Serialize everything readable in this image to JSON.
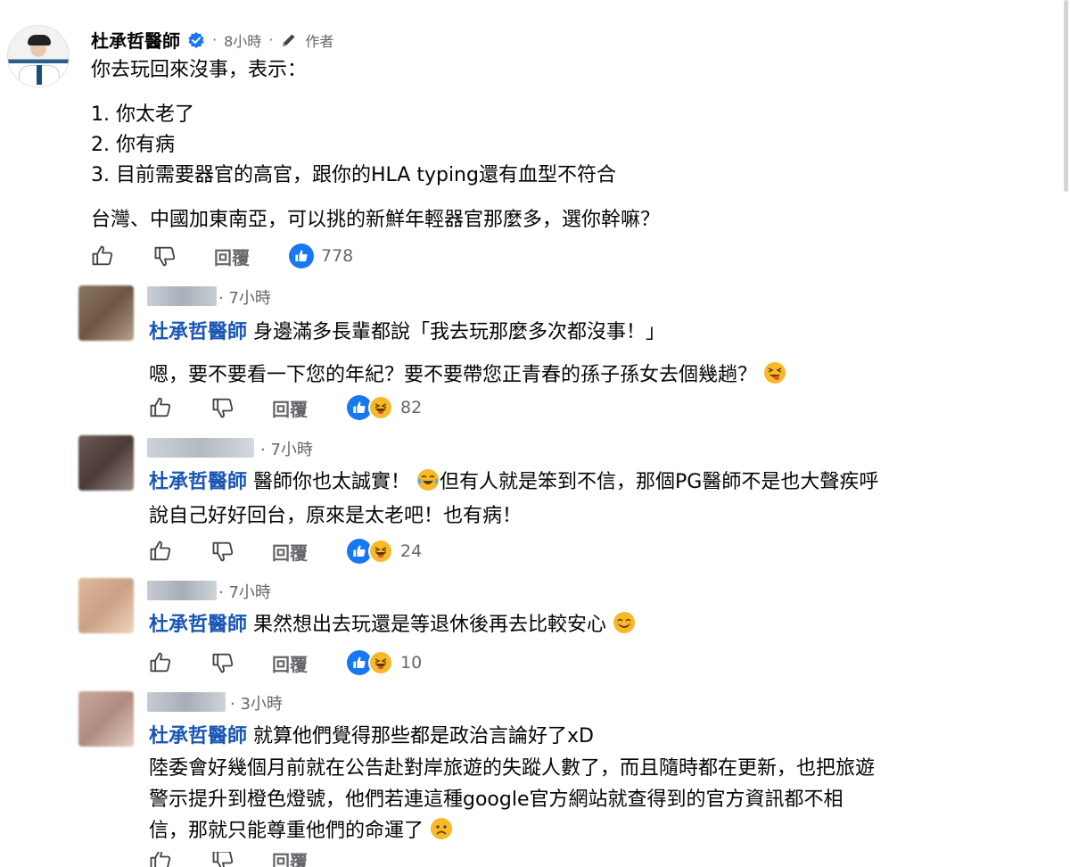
{
  "post": {
    "author": "杜承哲醫師",
    "time": "8小時",
    "author_tag": "作者",
    "lines": [
      "你去玩回來沒事，表示：",
      "1. 你太老了",
      "2. 你有病",
      "3. 目前需要器官的高官，跟你的HLA typing還有血型不符合",
      "台灣、中國加東南亞，可以挑的新鮮年輕器官那麼多，選你幹嘛？"
    ],
    "reply_label": "回覆",
    "reaction_count": "778"
  },
  "replies": [
    {
      "time": "7小時",
      "mention": "杜承哲醫師",
      "lines": [
        " 身邊滿多長輩都說「我去玩那麼多次都沒事！」",
        "嗯，要不要看一下您的年紀？要不要帶您正青春的孫子孫女去個幾趟？"
      ],
      "reply_label": "回覆",
      "reaction_count": "82"
    },
    {
      "time": "7小時",
      "mention": "杜承哲醫師",
      "lines": [
        " 醫師你也太誠實！",
        "但有人就是笨到不信，那個PG醫師不是也大聲疾呼",
        "說自己好好回台，原來是太老吧！也有病！"
      ],
      "reply_label": "回覆",
      "reaction_count": "24"
    },
    {
      "time": "7小時",
      "mention": "杜承哲醫師",
      "lines": [
        " 果然想出去玩還是等退休後再去比較安心"
      ],
      "reply_label": "回覆",
      "reaction_count": "10"
    },
    {
      "time": "3小時",
      "mention": "杜承哲醫師",
      "lines": [
        " 就算他們覺得那些都是政治言論好了xD",
        "陸委會好幾個月前就在公告赴對岸旅遊的失蹤人數了，而且隨時都在更新，也把旅遊",
        "警示提升到橙色燈號，他們若連這種google官方網站就查得到的官方資訊都不相",
        "信，那就只能尊重他們的命運了"
      ],
      "reply_label": "回覆"
    }
  ],
  "colors": {
    "like_blue": "#1877f2",
    "mention_blue": "#1a56b4",
    "meta_gray": "#65676b",
    "haha_yellow": "#f7b928"
  },
  "icons": [
    "verified-icon",
    "pencil-icon",
    "thumbs-up-icon",
    "thumbs-down-icon",
    "like-reaction-icon",
    "haha-reaction-icon"
  ]
}
